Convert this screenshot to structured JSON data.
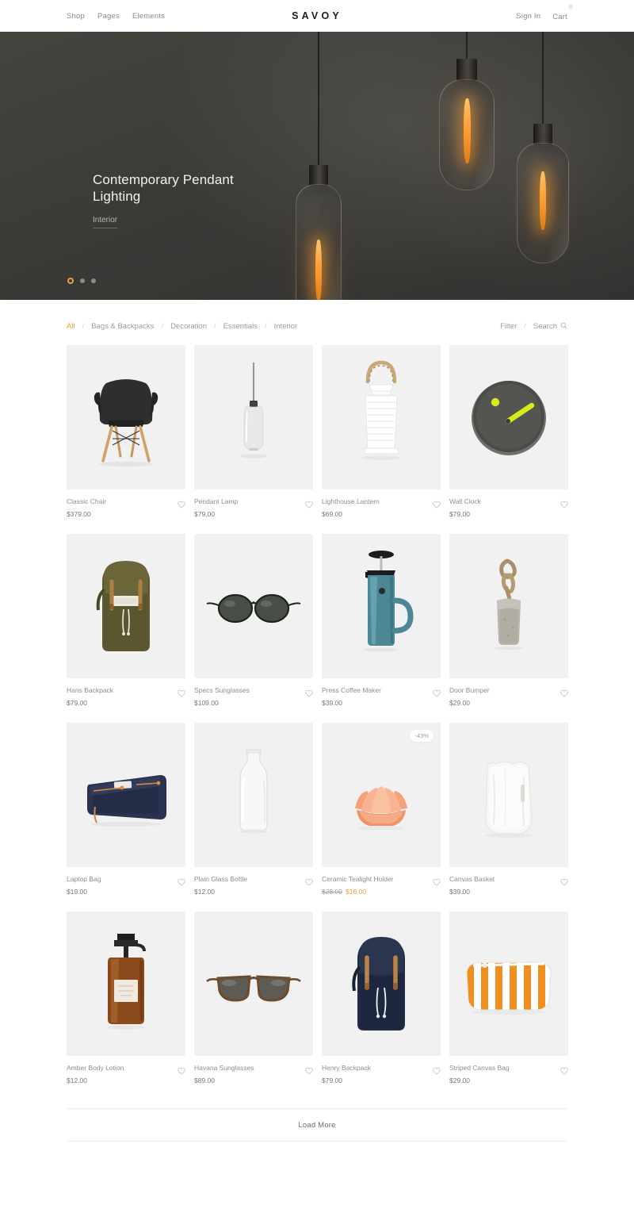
{
  "header": {
    "nav": [
      {
        "label": "Shop"
      },
      {
        "label": "Pages"
      },
      {
        "label": "Elements"
      }
    ],
    "logo": "SAVOY",
    "signin": "Sign In",
    "cart": "Cart",
    "cart_count": "0"
  },
  "hero": {
    "title": "Contemporary Pendant Lighting",
    "category": "Interior",
    "slides": 3,
    "active_slide": 1
  },
  "filterbar": {
    "categories": [
      {
        "label": "All",
        "active": true
      },
      {
        "label": "Bags & Backpacks",
        "active": false
      },
      {
        "label": "Decoration",
        "active": false
      },
      {
        "label": "Essentials",
        "active": false
      },
      {
        "label": "Interior",
        "active": false
      }
    ],
    "separator": "/",
    "filter": "Filter",
    "search": "Search",
    "search_icon": "search-icon"
  },
  "products": [
    {
      "name": "Classic Chair",
      "price": "$379.00",
      "old_price": "",
      "sale_price": "",
      "badge": ""
    },
    {
      "name": "Pendant Lamp",
      "price": "$79.00",
      "old_price": "",
      "sale_price": "",
      "badge": ""
    },
    {
      "name": "Lighthouse Lantern",
      "price": "$69.00",
      "old_price": "",
      "sale_price": "",
      "badge": ""
    },
    {
      "name": "Wall Clock",
      "price": "$79.00",
      "old_price": "",
      "sale_price": "",
      "badge": ""
    },
    {
      "name": "Hans Backpack",
      "price": "$79.00",
      "old_price": "",
      "sale_price": "",
      "badge": ""
    },
    {
      "name": "Specs Sunglasses",
      "price": "$109.00",
      "old_price": "",
      "sale_price": "",
      "badge": ""
    },
    {
      "name": "Press Coffee Maker",
      "price": "$39.00",
      "old_price": "",
      "sale_price": "",
      "badge": ""
    },
    {
      "name": "Door Bumper",
      "price": "$29.00",
      "old_price": "",
      "sale_price": "",
      "badge": ""
    },
    {
      "name": "Laptop Bag",
      "price": "$19.00",
      "old_price": "",
      "sale_price": "",
      "badge": ""
    },
    {
      "name": "Plain Glass Bottle",
      "price": "$12.00",
      "old_price": "",
      "sale_price": "",
      "badge": ""
    },
    {
      "name": "Ceramic Tealight Holder",
      "price": "",
      "old_price": "$28.00",
      "sale_price": "$16.00",
      "badge": "-43%"
    },
    {
      "name": "Canvas Basket",
      "price": "$39.00",
      "old_price": "",
      "sale_price": "",
      "badge": ""
    },
    {
      "name": "Amber Body Lotion",
      "price": "$12.00",
      "old_price": "",
      "sale_price": "",
      "badge": ""
    },
    {
      "name": "Havana Sunglasses",
      "price": "$89.00",
      "old_price": "",
      "sale_price": "",
      "badge": ""
    },
    {
      "name": "Henry Backpack",
      "price": "$79.00",
      "old_price": "",
      "sale_price": "",
      "badge": ""
    },
    {
      "name": "Striped Canvas Bag",
      "price": "$29.00",
      "old_price": "",
      "sale_price": "",
      "badge": ""
    }
  ],
  "footer": {
    "load_more": "Load More"
  },
  "colors": {
    "accent": "#e8a33d",
    "hero_bg": "#3b3a38",
    "tile_bg": "#f1f1f1",
    "text_muted": "#8e8e8e"
  }
}
